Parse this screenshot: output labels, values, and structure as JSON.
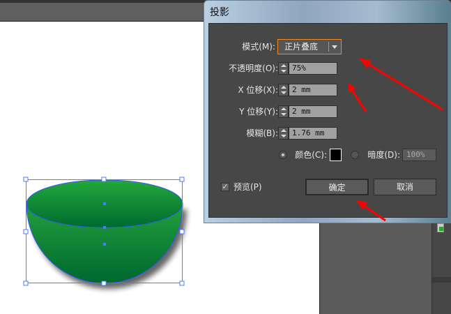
{
  "dialog": {
    "title": "投影",
    "mode": {
      "label": "模式(M):",
      "value": "正片叠底"
    },
    "opacity": {
      "label": "不透明度(O):",
      "value": "75%"
    },
    "x_offset": {
      "label": "X 位移(X):",
      "value": "2 mm"
    },
    "y_offset": {
      "label": "Y 位移(Y):",
      "value": "2 mm"
    },
    "blur": {
      "label": "模糊(B):",
      "value": "1.76 mm"
    },
    "color": {
      "label": "颜色(C):",
      "swatch": "#000000",
      "selected": true
    },
    "darkness": {
      "label": "暗度(D):",
      "value": "100%",
      "selected": false
    },
    "preview": {
      "label": "预览(P)",
      "checked": true
    },
    "ok_label": "确定",
    "cancel_label": "取消"
  },
  "colors": {
    "accent": "#f08a1c",
    "annotation": "#ff0000",
    "bowl": "#1a9a3c"
  }
}
